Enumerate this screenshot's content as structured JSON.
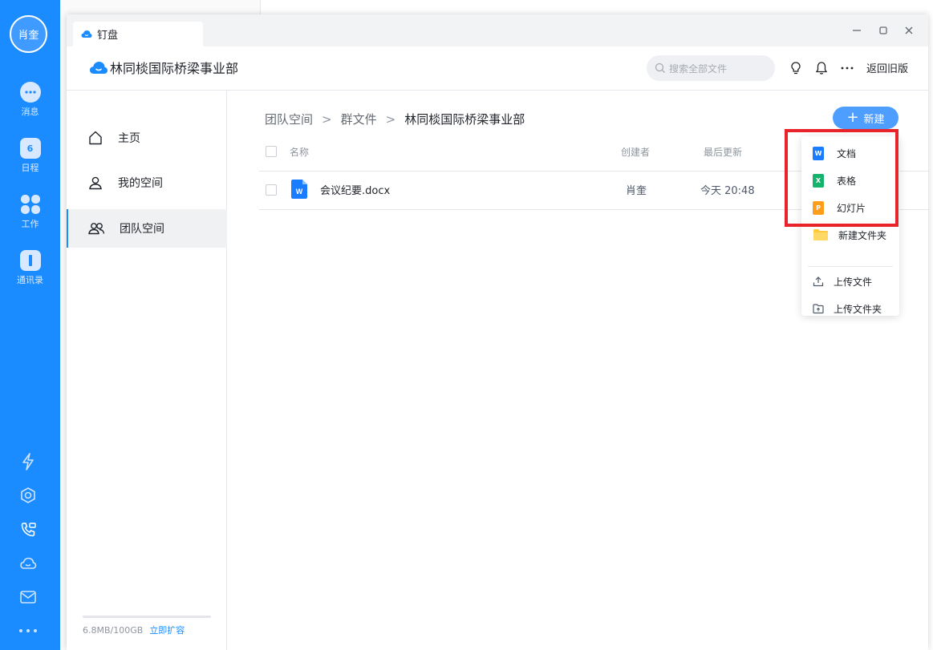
{
  "rail": {
    "avatar": "肖奎",
    "items": [
      {
        "label": "消息",
        "icon": "chat-icon"
      },
      {
        "label": "日程",
        "icon": "calendar-icon",
        "badge": "6"
      },
      {
        "label": "工作",
        "icon": "apps-icon"
      },
      {
        "label": "通讯录",
        "icon": "contacts-icon"
      }
    ],
    "bottom_icons": [
      "lightning-icon",
      "cube-icon",
      "phone-icon",
      "cloud-icon",
      "mail-icon",
      "more-icon"
    ]
  },
  "window": {
    "tab_title": "钉盘",
    "controls": [
      "minimize-icon",
      "maximize-icon",
      "close-icon"
    ]
  },
  "header": {
    "org_name": "林同棪国际桥梁事业部",
    "search_placeholder": "搜索全部文件",
    "back_link": "返回旧版"
  },
  "sidebar": {
    "items": [
      {
        "label": "主页",
        "icon": "home-icon",
        "active": false
      },
      {
        "label": "我的空间",
        "icon": "user-icon",
        "active": false
      },
      {
        "label": "团队空间",
        "icon": "team-icon",
        "active": true
      }
    ],
    "quota_text": "6.8MB/100GB",
    "quota_link": "立即扩容"
  },
  "main": {
    "breadcrumb": [
      "团队空间",
      "群文件",
      "林同棪国际桥梁事业部"
    ],
    "new_button": "新建",
    "columns": {
      "name": "名称",
      "creator": "创建者",
      "updated": "最后更新"
    },
    "files": [
      {
        "name": "会议纪要.docx",
        "creator": "肖奎",
        "updated": "今天 20:48",
        "icon": "word-file-icon"
      }
    ]
  },
  "new_menu": {
    "items": [
      {
        "label": "文档",
        "icon": "word-doc-icon",
        "color": "#1a7cff",
        "letter": "W"
      },
      {
        "label": "表格",
        "icon": "sheet-icon",
        "color": "#15b36b",
        "letter": "X"
      },
      {
        "label": "幻灯片",
        "icon": "slides-icon",
        "color": "#ff9e1b",
        "letter": "P"
      },
      {
        "label": "新建文件夹",
        "icon": "folder-icon",
        "color": "#ffc93e"
      },
      {
        "label": "上传文件",
        "icon": "upload-file-icon"
      },
      {
        "label": "上传文件夹",
        "icon": "upload-folder-icon"
      }
    ]
  },
  "colors": {
    "accent": "#1a8cff",
    "highlight": "#e8242a"
  }
}
